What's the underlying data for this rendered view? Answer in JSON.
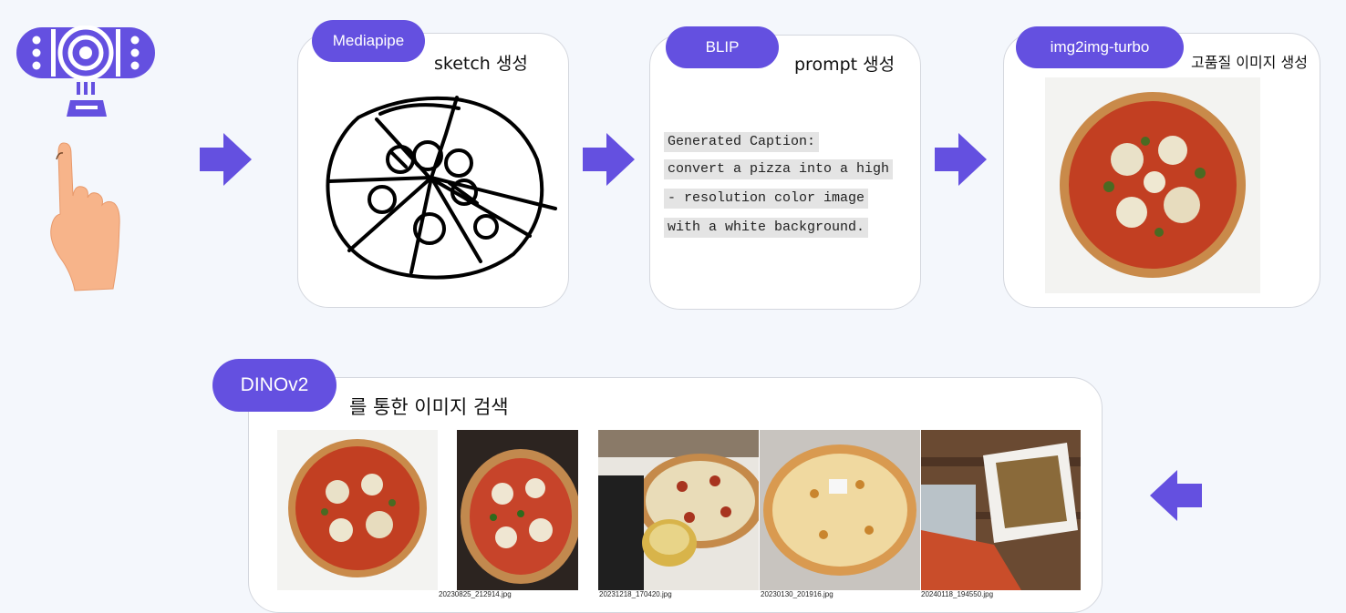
{
  "steps": [
    {
      "tag": "Mediapipe",
      "caption": "sketch 생성"
    },
    {
      "tag": "BLIP",
      "caption": "prompt 생성"
    },
    {
      "tag": "img2img-turbo",
      "caption": "고품질 이미지 생성"
    }
  ],
  "blip_output": {
    "lines": [
      "Generated Caption:",
      " convert a pizza into a high",
      "- resolution color image",
      "with a white background."
    ]
  },
  "search": {
    "tag": "DINOv2",
    "caption": "를 통한 이미지 검색",
    "results": [
      {
        "filename": "20230825_212914.jpg"
      },
      {
        "filename": "20231218_170420.jpg"
      },
      {
        "filename": "20230130_201916.jpg"
      },
      {
        "filename": "20240118_194550.jpg"
      }
    ]
  },
  "icons": [
    "webcam-icon",
    "pointing-hand-icon",
    "arrow-right-icon",
    "arrow-left-icon"
  ],
  "colors": {
    "accent": "#6450e0",
    "hand": "#f7b48a",
    "background": "#f4f7fc"
  }
}
